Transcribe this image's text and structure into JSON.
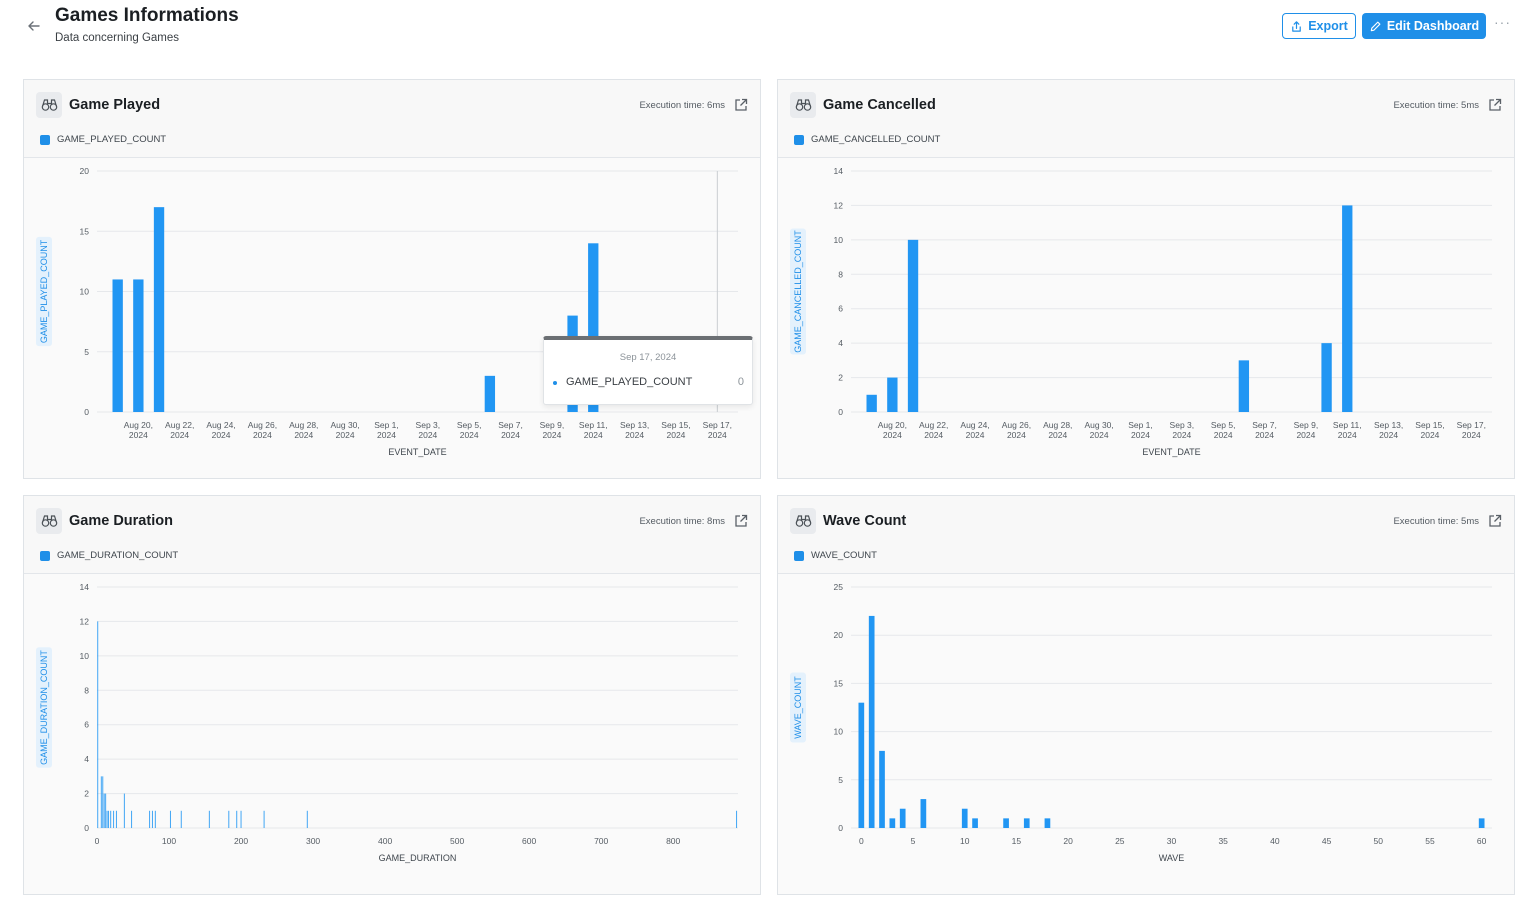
{
  "header": {
    "title": "Games Informations",
    "subtitle": "Data concerning Games",
    "export_label": "Export",
    "edit_label": "Edit Dashboard",
    "more_label": "···"
  },
  "colors": {
    "accent": "#1f8fe8",
    "bar": "#2196f3"
  },
  "cards": [
    {
      "title": "Game Played",
      "exec": "Execution time: 6ms",
      "legend": "GAME_PLAYED_COUNT"
    },
    {
      "title": "Game Cancelled",
      "exec": "Execution time: 5ms",
      "legend": "GAME_CANCELLED_COUNT"
    },
    {
      "title": "Game Duration",
      "exec": "Execution time: 8ms",
      "legend": "GAME_DURATION_COUNT"
    },
    {
      "title": "Wave Count",
      "exec": "Execution time: 5ms",
      "legend": "WAVE_COUNT"
    }
  ],
  "tooltip": {
    "date": "Sep 17, 2024",
    "series": "GAME_PLAYED_COUNT",
    "value": "0"
  },
  "chart_data": [
    {
      "type": "bar",
      "title": "Game Played",
      "xlabel": "EVENT_DATE",
      "ylabel": "GAME_PLAYED_COUNT",
      "ylim": [
        0,
        20
      ],
      "yticks": [
        0,
        5,
        10,
        15,
        20
      ],
      "xlim": [
        "2024-08-18",
        "2024-09-18"
      ],
      "xticks": [
        {
          "date": "2024-08-20",
          "l1": "Aug 20,",
          "l2": "2024"
        },
        {
          "date": "2024-08-22",
          "l1": "Aug 22,",
          "l2": "2024"
        },
        {
          "date": "2024-08-24",
          "l1": "Aug 24,",
          "l2": "2024"
        },
        {
          "date": "2024-08-26",
          "l1": "Aug 26,",
          "l2": "2024"
        },
        {
          "date": "2024-08-28",
          "l1": "Aug 28,",
          "l2": "2024"
        },
        {
          "date": "2024-08-30",
          "l1": "Aug 30,",
          "l2": "2024"
        },
        {
          "date": "2024-09-01",
          "l1": "Sep 1,",
          "l2": "2024"
        },
        {
          "date": "2024-09-03",
          "l1": "Sep 3,",
          "l2": "2024"
        },
        {
          "date": "2024-09-05",
          "l1": "Sep 5,",
          "l2": "2024"
        },
        {
          "date": "2024-09-07",
          "l1": "Sep 7,",
          "l2": "2024"
        },
        {
          "date": "2024-09-09",
          "l1": "Sep 9,",
          "l2": "2024"
        },
        {
          "date": "2024-09-11",
          "l1": "Sep 11,",
          "l2": "2024"
        },
        {
          "date": "2024-09-13",
          "l1": "Sep 13,",
          "l2": "2024"
        },
        {
          "date": "2024-09-15",
          "l1": "Sep 15,",
          "l2": "2024"
        },
        {
          "date": "2024-09-17",
          "l1": "Sep 17,",
          "l2": "2024"
        }
      ],
      "points": [
        {
          "date": "2024-08-19",
          "value": 11
        },
        {
          "date": "2024-08-20",
          "value": 11
        },
        {
          "date": "2024-08-21",
          "value": 17
        },
        {
          "date": "2024-09-06",
          "value": 3
        },
        {
          "date": "2024-09-10",
          "value": 8
        },
        {
          "date": "2024-09-11",
          "value": 14
        }
      ],
      "hover_date": "2024-09-17",
      "grid": true
    },
    {
      "type": "bar",
      "title": "Game Cancelled",
      "xlabel": "EVENT_DATE",
      "ylabel": "GAME_CANCELLED_COUNT",
      "ylim": [
        0,
        14
      ],
      "yticks": [
        0,
        2,
        4,
        6,
        8,
        10,
        12,
        14
      ],
      "xlim": [
        "2024-08-18",
        "2024-09-18"
      ],
      "xticks": [
        {
          "date": "2024-08-20",
          "l1": "Aug 20,",
          "l2": "2024"
        },
        {
          "date": "2024-08-22",
          "l1": "Aug 22,",
          "l2": "2024"
        },
        {
          "date": "2024-08-24",
          "l1": "Aug 24,",
          "l2": "2024"
        },
        {
          "date": "2024-08-26",
          "l1": "Aug 26,",
          "l2": "2024"
        },
        {
          "date": "2024-08-28",
          "l1": "Aug 28,",
          "l2": "2024"
        },
        {
          "date": "2024-08-30",
          "l1": "Aug 30,",
          "l2": "2024"
        },
        {
          "date": "2024-09-01",
          "l1": "Sep 1,",
          "l2": "2024"
        },
        {
          "date": "2024-09-03",
          "l1": "Sep 3,",
          "l2": "2024"
        },
        {
          "date": "2024-09-05",
          "l1": "Sep 5,",
          "l2": "2024"
        },
        {
          "date": "2024-09-07",
          "l1": "Sep 7,",
          "l2": "2024"
        },
        {
          "date": "2024-09-09",
          "l1": "Sep 9,",
          "l2": "2024"
        },
        {
          "date": "2024-09-11",
          "l1": "Sep 11,",
          "l2": "2024"
        },
        {
          "date": "2024-09-13",
          "l1": "Sep 13,",
          "l2": "2024"
        },
        {
          "date": "2024-09-15",
          "l1": "Sep 15,",
          "l2": "2024"
        },
        {
          "date": "2024-09-17",
          "l1": "Sep 17,",
          "l2": "2024"
        }
      ],
      "points": [
        {
          "date": "2024-08-19",
          "value": 1
        },
        {
          "date": "2024-08-20",
          "value": 2
        },
        {
          "date": "2024-08-21",
          "value": 10
        },
        {
          "date": "2024-09-06",
          "value": 3
        },
        {
          "date": "2024-09-10",
          "value": 4
        },
        {
          "date": "2024-09-11",
          "value": 12
        }
      ],
      "grid": true
    },
    {
      "type": "bar",
      "title": "Game Duration",
      "xlabel": "GAME_DURATION",
      "ylabel": "GAME_DURATION_COUNT",
      "ylim": [
        0,
        14
      ],
      "yticks": [
        0,
        2,
        4,
        6,
        8,
        10,
        12,
        14
      ],
      "xlim": [
        0,
        890
      ],
      "xticks": [
        0,
        100,
        200,
        300,
        400,
        500,
        600,
        700,
        800
      ],
      "points": [
        {
          "x": 1,
          "value": 12
        },
        {
          "x": 6,
          "value": 3
        },
        {
          "x": 8,
          "value": 3
        },
        {
          "x": 10,
          "value": 2
        },
        {
          "x": 12,
          "value": 2
        },
        {
          "x": 14,
          "value": 1
        },
        {
          "x": 16,
          "value": 1
        },
        {
          "x": 19,
          "value": 1
        },
        {
          "x": 23,
          "value": 1
        },
        {
          "x": 27,
          "value": 1
        },
        {
          "x": 38,
          "value": 2
        },
        {
          "x": 48,
          "value": 1
        },
        {
          "x": 73,
          "value": 1
        },
        {
          "x": 77,
          "value": 1
        },
        {
          "x": 81,
          "value": 1
        },
        {
          "x": 102,
          "value": 1
        },
        {
          "x": 117,
          "value": 1
        },
        {
          "x": 156,
          "value": 1
        },
        {
          "x": 183,
          "value": 1
        },
        {
          "x": 194,
          "value": 1
        },
        {
          "x": 200,
          "value": 1
        },
        {
          "x": 232,
          "value": 1
        },
        {
          "x": 292,
          "value": 1
        },
        {
          "x": 888,
          "value": 1
        }
      ],
      "grid": true
    },
    {
      "type": "bar",
      "title": "Wave Count",
      "xlabel": "WAVE",
      "ylabel": "WAVE_COUNT",
      "ylim": [
        0,
        25
      ],
      "yticks": [
        0,
        5,
        10,
        15,
        20,
        25
      ],
      "xlim": [
        -1,
        61
      ],
      "xticks": [
        0,
        5,
        10,
        15,
        20,
        25,
        30,
        35,
        40,
        45,
        50,
        55,
        60
      ],
      "points": [
        {
          "x": 0,
          "value": 13
        },
        {
          "x": 1,
          "value": 22
        },
        {
          "x": 2,
          "value": 8
        },
        {
          "x": 3,
          "value": 1
        },
        {
          "x": 4,
          "value": 2
        },
        {
          "x": 6,
          "value": 3
        },
        {
          "x": 10,
          "value": 2
        },
        {
          "x": 11,
          "value": 1
        },
        {
          "x": 14,
          "value": 1
        },
        {
          "x": 16,
          "value": 1
        },
        {
          "x": 18,
          "value": 1
        },
        {
          "x": 60,
          "value": 1
        }
      ],
      "grid": true
    }
  ]
}
